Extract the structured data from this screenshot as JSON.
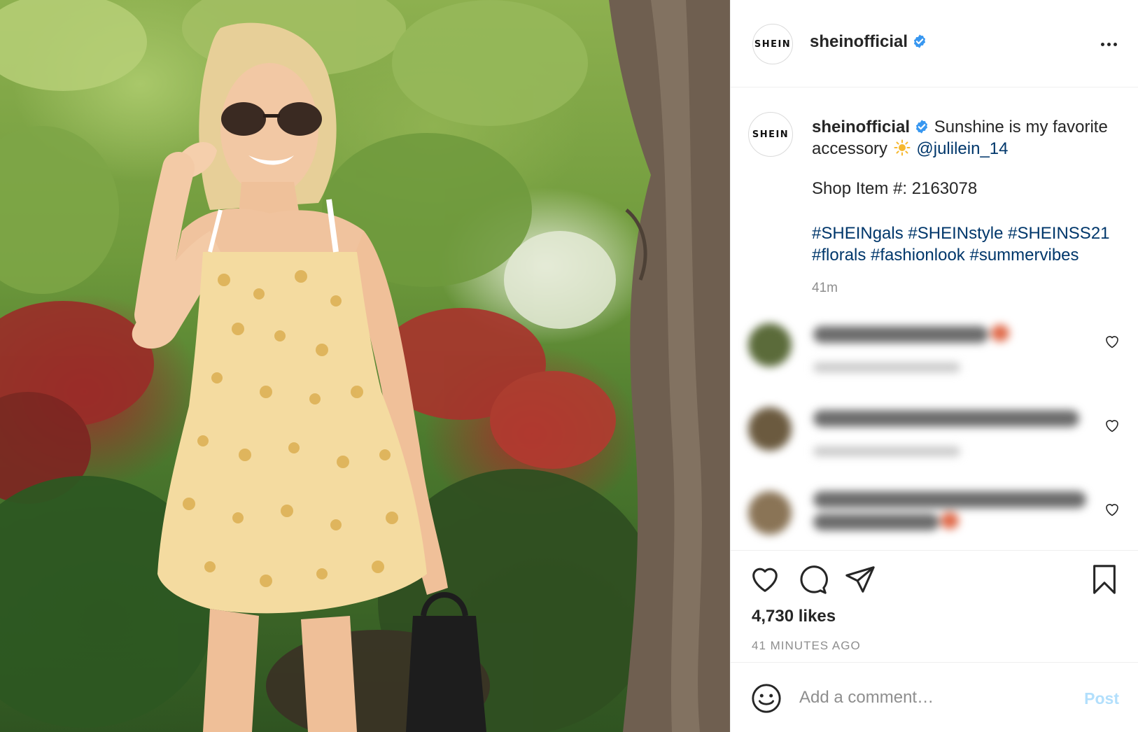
{
  "post": {
    "photo": {
      "alt_subject": "woman-in-floral-dress",
      "palette": {
        "foliage": "#7fa544",
        "flowers": "#a3302b",
        "bark": "#6a5a4b",
        "dress": "#f3d28a"
      }
    },
    "header": {
      "avatar_text": "SHEIN",
      "username": "sheinofficial",
      "verified_icon": "verified-badge-icon",
      "more_icon": "more-options-icon"
    },
    "caption": {
      "avatar_text": "SHEIN",
      "username": "sheinofficial",
      "text": "Sunshine is my favorite",
      "text_line2": "accessory",
      "emoji_icon": "sun-emoji-icon",
      "mention": "@julilein_14",
      "item_line": "Shop Item #: 2163078",
      "hashtags_line1": "#SHEINgals #SHEINstyle #SHEINSS21",
      "hashtags_line2": "#florals #fashionlook #summervibes",
      "time": "41m"
    },
    "comments": [
      {
        "blurred": true,
        "avatar_color": "#5b6b3a"
      },
      {
        "blurred": true,
        "avatar_color": "#6b5a3f"
      },
      {
        "blurred": true,
        "avatar_color": "#8a7456"
      }
    ],
    "actions": {
      "like_icon": "heart-icon",
      "comment_icon": "comment-icon",
      "share_icon": "share-icon",
      "save_icon": "bookmark-icon",
      "likes": "4,730 likes",
      "time_ago": "41 MINUTES AGO"
    },
    "composer": {
      "emoji_icon": "smiley-icon",
      "placeholder": "Add a comment…",
      "post_label": "Post",
      "post_color": "#b2dffc"
    },
    "colors": {
      "link": "#00376b",
      "verified": "#3897f0",
      "muted": "#8e8e8e",
      "text": "#262626"
    }
  }
}
